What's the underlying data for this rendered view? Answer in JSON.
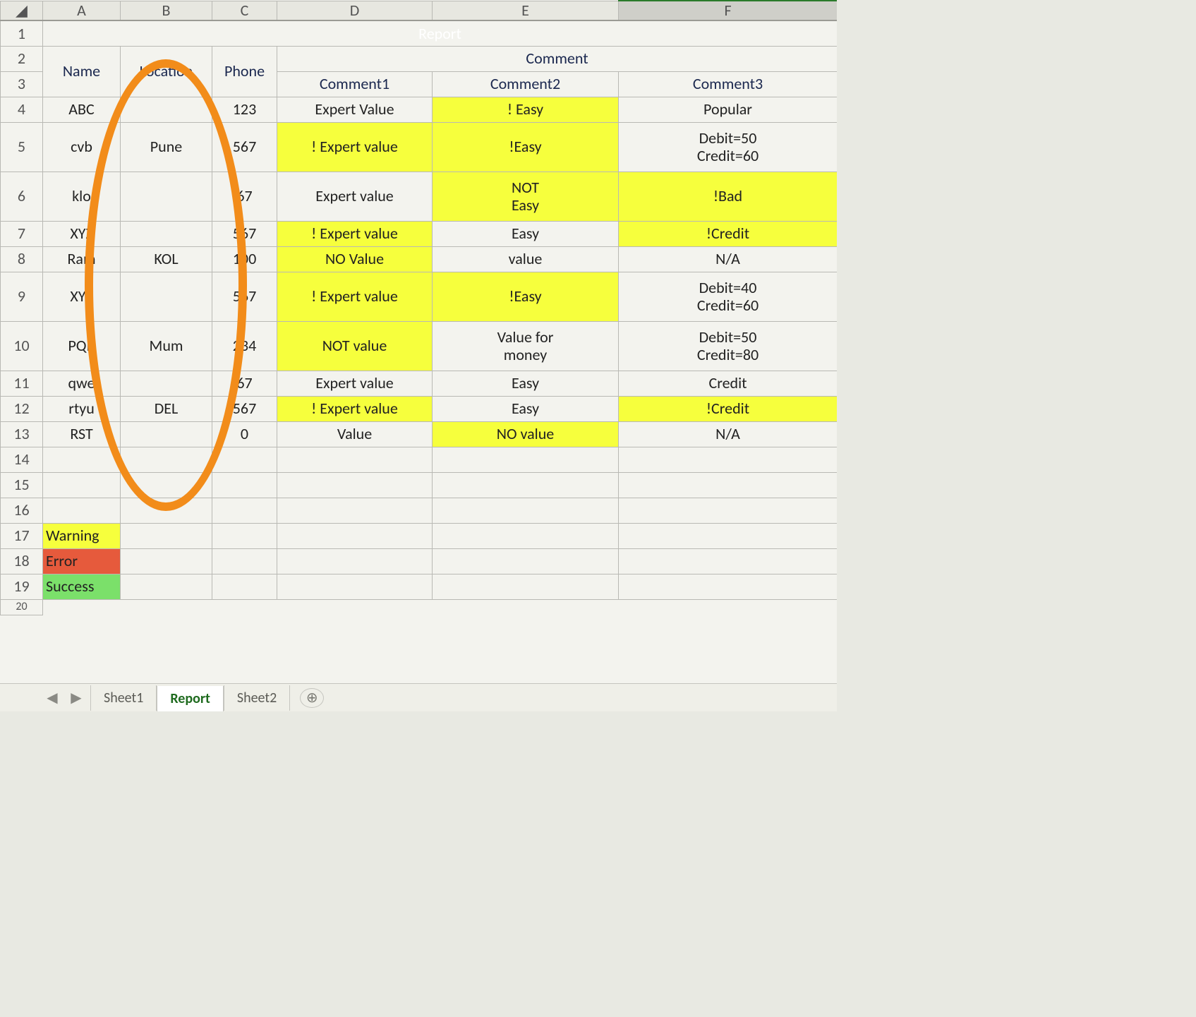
{
  "columns": [
    "A",
    "B",
    "C",
    "D",
    "E",
    "F"
  ],
  "title": "Report",
  "headers": {
    "name": "Name",
    "location": "Location",
    "phone": "Phone",
    "comment": "Comment",
    "comment1": "Comment1",
    "comment2": "Comment2",
    "comment3": "Comment3"
  },
  "rows": [
    {
      "rn": 4,
      "name": "ABC",
      "location": "",
      "phone": "123",
      "c1": "Expert Value",
      "c2": "! Easy",
      "c3": "Popular",
      "c1hl": false,
      "c2hl": true,
      "c3hl": false,
      "c3two": false,
      "h": ""
    },
    {
      "rn": 5,
      "name": "cvb",
      "location": "Pune",
      "phone": "567",
      "c1": "! Expert value",
      "c2": "!Easy",
      "c3": "Debit=50\nCredit=60",
      "c1hl": true,
      "c2hl": true,
      "c3hl": false,
      "c3two": true,
      "h": "h70"
    },
    {
      "rn": 6,
      "name": "klo",
      "location": "",
      "phone": "67",
      "c1": "Expert value",
      "c2": "NOT\nEasy",
      "c3": "!Bad",
      "c1hl": false,
      "c2hl": true,
      "c3hl": true,
      "c3two": false,
      "h": "h70"
    },
    {
      "rn": 7,
      "name": "XYZ",
      "location": "",
      "phone": "567",
      "c1": "! Expert value",
      "c2": "Easy",
      "c3": "!Credit",
      "c1hl": true,
      "c2hl": false,
      "c3hl": true,
      "c3two": false,
      "h": ""
    },
    {
      "rn": 8,
      "name": "Ram",
      "location": "KOL",
      "phone": "100",
      "c1": "NO Value",
      "c2": "value",
      "c3": "N/A",
      "c1hl": true,
      "c2hl": false,
      "c3hl": false,
      "c3two": false,
      "h": ""
    },
    {
      "rn": 9,
      "name": "XYZ",
      "location": "",
      "phone": "567",
      "c1": "! Expert value",
      "c2": "!Easy",
      "c3": "Debit=40\nCredit=60",
      "c1hl": true,
      "c2hl": true,
      "c3hl": false,
      "c3two": true,
      "h": "h70"
    },
    {
      "rn": 10,
      "name": "PQR",
      "location": "Mum",
      "phone": "234",
      "c1": "NOT value",
      "c2": "Value for\nmoney",
      "c3": "Debit=50\nCredit=80",
      "c1hl": true,
      "c2hl": false,
      "c3hl": false,
      "c3two": true,
      "h": "h70"
    },
    {
      "rn": 11,
      "name": "qwe",
      "location": "",
      "phone": "67",
      "c1": "Expert value",
      "c2": "Easy",
      "c3": "Credit",
      "c1hl": false,
      "c2hl": false,
      "c3hl": false,
      "c3two": false,
      "h": ""
    },
    {
      "rn": 12,
      "name": "rtyu",
      "location": "DEL",
      "phone": "567",
      "c1": "! Expert value",
      "c2": "Easy",
      "c3": "!Credit",
      "c1hl": true,
      "c2hl": false,
      "c3hl": true,
      "c3two": false,
      "h": ""
    },
    {
      "rn": 13,
      "name": "RST",
      "location": "",
      "phone": "0",
      "c1": "Value",
      "c2": "NO value",
      "c3": "N/A",
      "c1hl": false,
      "c2hl": true,
      "c3hl": false,
      "c3two": false,
      "h": ""
    }
  ],
  "locationMerges": [
    {
      "startRow": 4,
      "span": 2,
      "value": "Pune"
    },
    {
      "startRow": 6,
      "span": 4,
      "value": "KOL"
    },
    {
      "startRow": 10,
      "span": 3,
      "value": "Mum"
    }
  ],
  "emptyRows": [
    14,
    15,
    16
  ],
  "legend": [
    {
      "rn": 17,
      "label": "Warning",
      "cls": "hlYellow"
    },
    {
      "rn": 18,
      "label": "Error",
      "cls": "hlRed"
    },
    {
      "rn": 19,
      "label": "Success",
      "cls": "hlGreen"
    }
  ],
  "lastRow": 20,
  "tabs": {
    "items": [
      "Sheet1",
      "Report",
      "Sheet2"
    ],
    "active": "Report"
  },
  "colors": {
    "titleBg": "#2f8f3a",
    "headerBg": "#2b6fd0",
    "highlight": "#f6ff3d",
    "error": "#e65a3c",
    "success": "#7be06a",
    "annotation": "#f28c1a"
  }
}
